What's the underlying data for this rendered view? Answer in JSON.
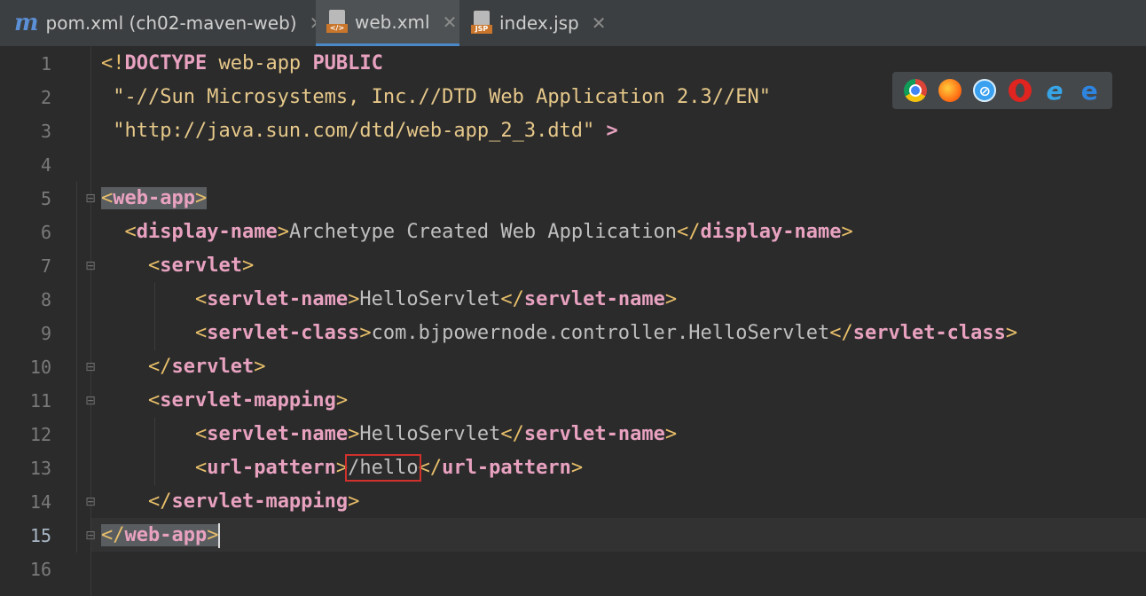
{
  "tabs": [
    {
      "label": "pom.xml (ch02-maven-web)",
      "icon": "maven-icon",
      "active": false,
      "close": "✕"
    },
    {
      "label": "web.xml",
      "icon": "xml-file-icon",
      "active": true,
      "close": "✕"
    },
    {
      "label": "index.jsp",
      "icon": "jsp-file-icon",
      "active": false,
      "close": "✕"
    }
  ],
  "file_badges": {
    "xml": "</>",
    "jsp": "JSP"
  },
  "gutter": {
    "line_numbers": [
      "1",
      "2",
      "3",
      "4",
      "5",
      "6",
      "7",
      "8",
      "9",
      "10",
      "11",
      "12",
      "13",
      "14",
      "15",
      "16"
    ],
    "current_line": "15"
  },
  "code": {
    "l1": {
      "a": "<!",
      "b": "DOCTYPE",
      "c": " web-app ",
      "d": "PUBLIC"
    },
    "l2": {
      "text": " \"-//Sun Microsystems, Inc.//DTD Web Application 2.3//EN\""
    },
    "l3": {
      "text": " \"http://java.sun.com/dtd/web-app_2_3.dtd\" ",
      "close": ">"
    },
    "l5": {
      "open": "<",
      "name": "web-app",
      "close": ">"
    },
    "l6": {
      "indent": "  ",
      "open": "<",
      "name": "display-name",
      "close": ">",
      "text": "Archetype Created Web Application",
      "end_open": "</",
      "end_name": "display-name",
      "end_close": ">"
    },
    "l7": {
      "indent": "    ",
      "open": "<",
      "name": "servlet",
      "close": ">"
    },
    "l8": {
      "indent": "        ",
      "open": "<",
      "name": "servlet-name",
      "close": ">",
      "text": "HelloServlet",
      "end_open": "</",
      "end_name": "servlet-name",
      "end_close": ">"
    },
    "l9": {
      "indent": "        ",
      "open": "<",
      "name": "servlet-class",
      "close": ">",
      "text": "com.bjpowernode.controller.HelloServlet",
      "end_open": "</",
      "end_name": "servlet-class",
      "end_close": ">"
    },
    "l10": {
      "indent": "    ",
      "open": "</",
      "name": "servlet",
      "close": ">"
    },
    "l11": {
      "indent": "    ",
      "open": "<",
      "name": "servlet-mapping",
      "close": ">"
    },
    "l12": {
      "indent": "        ",
      "open": "<",
      "name": "servlet-name",
      "close": ">",
      "text": "HelloServlet",
      "end_open": "</",
      "end_name": "servlet-name",
      "end_close": ">"
    },
    "l13": {
      "indent": "        ",
      "open": "<",
      "name": "url-pattern",
      "close": ">",
      "text": "/hello",
      "end_open": "</",
      "end_name": "url-pattern",
      "end_close": ">"
    },
    "l14": {
      "indent": "    ",
      "open": "</",
      "name": "servlet-mapping",
      "close": ">"
    },
    "l15": {
      "open": "</",
      "name": "web-app",
      "close": ">"
    }
  },
  "browsers": [
    "chrome-icon",
    "firefox-icon",
    "safari-icon",
    "opera-icon",
    "internet-explorer-icon",
    "edge-icon"
  ],
  "colors": {
    "tag_name": "#e8a2c0",
    "bracket": "#e8bf6a",
    "string": "#e6c88a",
    "text": "#bfbfbf",
    "active_tab_underline": "#4a88c7",
    "highlight_box": "#d0312d"
  }
}
